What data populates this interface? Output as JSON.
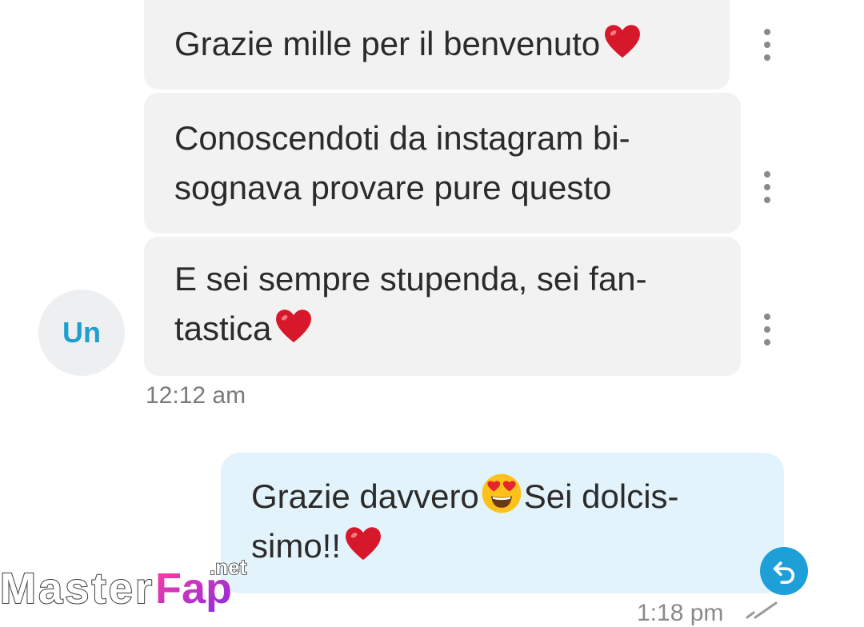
{
  "messages": {
    "incoming": [
      {
        "lines": [
          "Grazie mille per il benvenuto"
        ]
      },
      {
        "lines": [
          "Conoscendoti da instagram bi-",
          "sognava provare pure questo"
        ]
      },
      {
        "lines": [
          "E sei sempre stupenda, sei fan-",
          "tastica"
        ]
      }
    ],
    "incoming_time": "12:12 am",
    "outgoing": {
      "lines_a": "Grazie davvero",
      "lines_b": "Sei dolcis-",
      "line2": "simo!!"
    },
    "outgoing_time": "1:18 pm"
  },
  "avatar": {
    "initials": "Un"
  },
  "watermark": {
    "main_a": "Master",
    "main_b": "Fap",
    "suffix": ".net"
  },
  "colors": {
    "incoming_bubble": "#f2f2f3",
    "outgoing_bubble": "#e3f3fb",
    "accent": "#1e9fd8",
    "heart": "#d7182a"
  },
  "icons": [
    "heart-emoji",
    "heart-eyes-emoji",
    "more-vert-icon",
    "reply-icon",
    "check-icon"
  ]
}
